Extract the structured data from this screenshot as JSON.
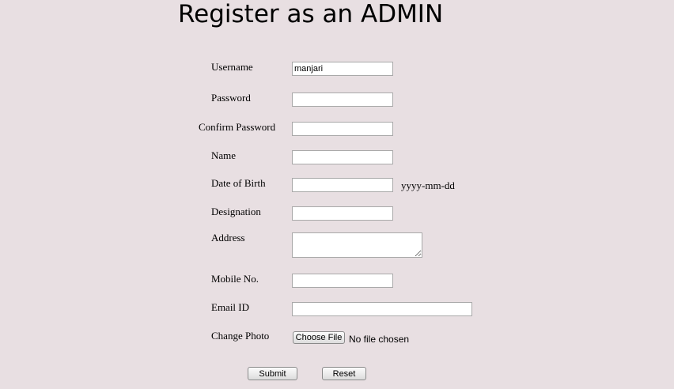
{
  "page": {
    "title": "Register as an ADMIN"
  },
  "form": {
    "username": {
      "label": "Username",
      "value": "manjari"
    },
    "password": {
      "label": "Password",
      "value": ""
    },
    "confirm_password": {
      "label": "Confirm Password",
      "value": ""
    },
    "name": {
      "label": "Name",
      "value": ""
    },
    "dob": {
      "label": "Date of Birth",
      "value": "",
      "hint": "yyyy-mm-dd"
    },
    "designation": {
      "label": "Designation",
      "value": ""
    },
    "address": {
      "label": "Address",
      "value": ""
    },
    "mobile": {
      "label": "Mobile No.",
      "value": ""
    },
    "email": {
      "label": "Email ID",
      "value": ""
    },
    "photo": {
      "label": "Change Photo",
      "button_label": "Choose File",
      "status": "No file chosen"
    }
  },
  "actions": {
    "submit_label": "Submit",
    "reset_label": "Reset"
  }
}
